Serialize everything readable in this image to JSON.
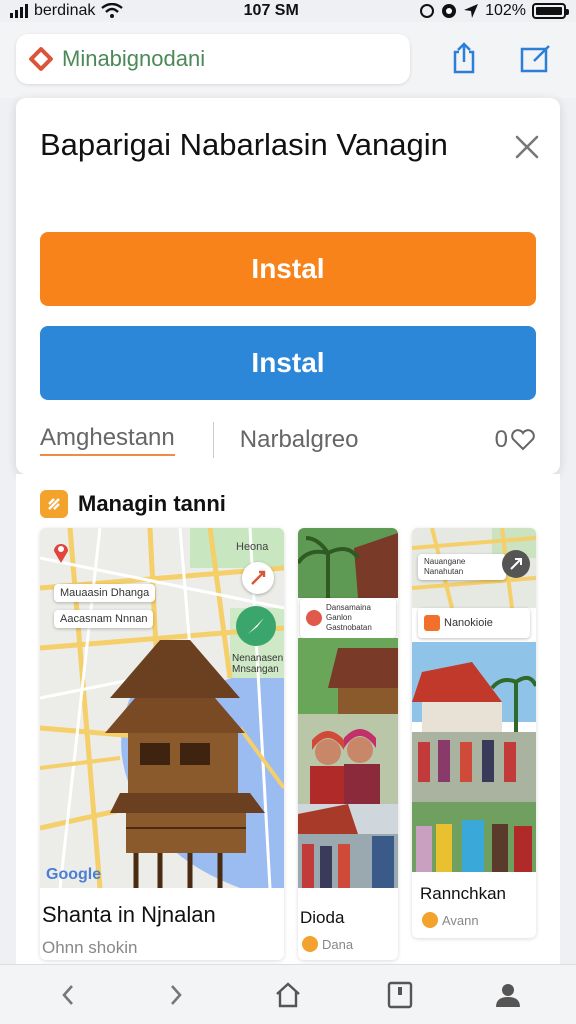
{
  "status": {
    "carrier": "berdinak",
    "time": "107 SM",
    "battery": "102%"
  },
  "browser": {
    "url": "Minabignodani"
  },
  "modal": {
    "title": "Baparigai Nabarlasin Vanagin",
    "primary_label": "Instal",
    "secondary_label": "Instal",
    "link_left": "Amghestann",
    "link_right": "Narbalgreo",
    "count": "0"
  },
  "section": {
    "title": "Managin tanni",
    "tile1": {
      "name": "Shanta in Njnalan",
      "sub": "Ohnn shokin",
      "map_labels": {
        "top_right": "Heona",
        "chip1": "Mauaasin Dhanga",
        "chip2": "Aacasnam Nnnan",
        "mid_right": "Nenanasen Mnsangan"
      },
      "map_brand": "Google"
    },
    "tile2": {
      "card_label": "Dansamaina Ganlon Gastnobatan",
      "caption": "Dioda",
      "caption2": "Dana"
    },
    "tile3": {
      "chip_top": "Nauangane Nanahutan",
      "card_label": "Nanokioie",
      "caption": "Rannchkan",
      "caption2": "Avann"
    }
  },
  "colors": {
    "install_orange": "#f7831a",
    "install_blue": "#2c87d8",
    "accent": "#f3a22b"
  }
}
